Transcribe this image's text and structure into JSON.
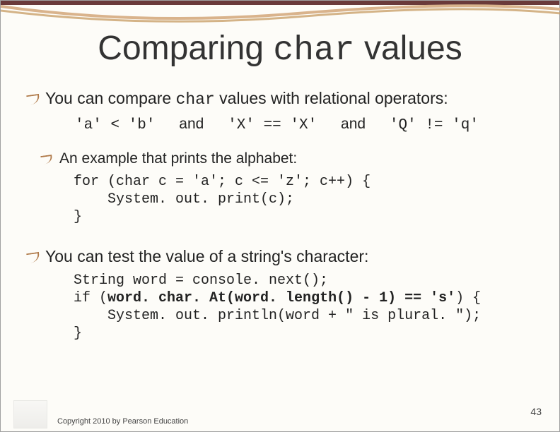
{
  "title": {
    "part1": "Comparing ",
    "code": "char",
    "part2": " values"
  },
  "bullets": {
    "b1": {
      "text1": "You can compare ",
      "code": "char",
      "text2": " values with relational operators:"
    },
    "examples": {
      "e1": "'a' < 'b'",
      "sep1": "and",
      "e2": "'X' == 'X'",
      "sep2": "and",
      "e3": "'Q' != 'q'"
    },
    "b2": "An example that prints the alphabet:",
    "code1": "for (char c = 'a'; c <= 'z'; c++) {\n    System. out. print(c);\n}",
    "b3": "You can test the value of a string's character:",
    "code2_line1": "String word = console. next();",
    "code2_line2a": "if (",
    "code2_line2b": "word. char. At(word. length() - 1) == 's'",
    "code2_line2c": ") {",
    "code2_line3": "    System. out. println(word + \" is plural. \");",
    "code2_line4": "}"
  },
  "footer": {
    "page": "43",
    "copyright": "Copyright 2010 by Pearson Education"
  }
}
